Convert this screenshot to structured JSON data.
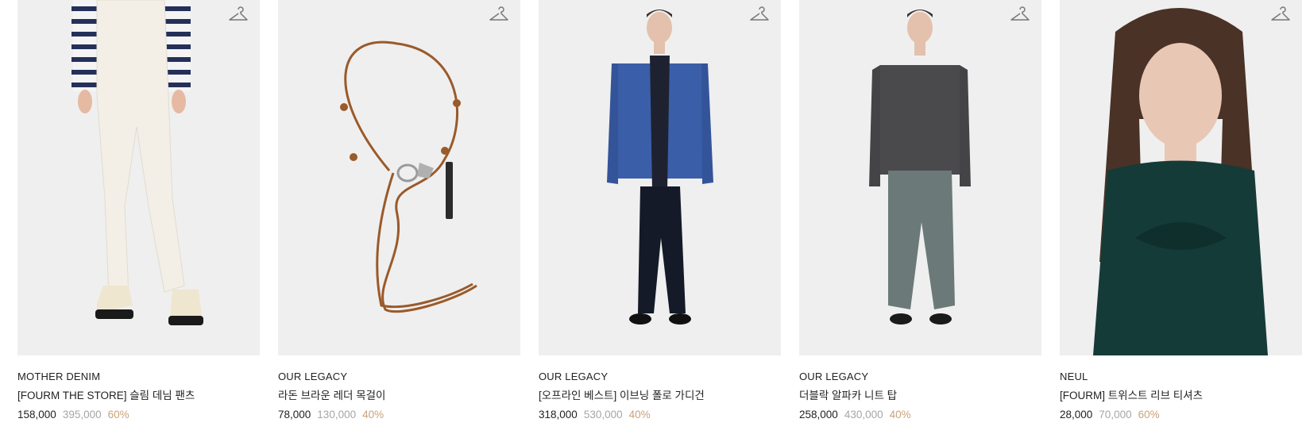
{
  "products": [
    {
      "brand": "MOTHER DENIM",
      "title": "[FOURM THE STORE] 슬림 데님 팬츠",
      "price": "158,000",
      "original_price": "395,000",
      "discount": "60%",
      "image_icon": "white-flare-jeans-image"
    },
    {
      "brand": "OUR LEGACY",
      "title": "라돈 브라운 레더 목걸이",
      "price": "78,000",
      "original_price": "130,000",
      "discount": "40%",
      "image_icon": "brown-leather-necklace-image"
    },
    {
      "brand": "OUR LEGACY",
      "title": "[오프라인 베스트] 이브닝 폴로 가디건",
      "price": "318,000",
      "original_price": "530,000",
      "discount": "40%",
      "image_icon": "blue-cardigan-model-image"
    },
    {
      "brand": "OUR LEGACY",
      "title": "더블락 알파카 니트 탑",
      "price": "258,000",
      "original_price": "430,000",
      "discount": "40%",
      "image_icon": "grey-knit-model-image"
    },
    {
      "brand": "NEUL",
      "title": "[FOURM] 트위스트 리브 티셔츠",
      "price": "28,000",
      "original_price": "70,000",
      "discount": "60%",
      "image_icon": "green-rib-tshirt-model-image"
    }
  ],
  "icons": {
    "wishlist": "hanger-icon"
  },
  "colors": {
    "text": "#222222",
    "original_price": "#a6a6a6",
    "discount": "#c9a27a",
    "image_bg": "#efefef"
  }
}
